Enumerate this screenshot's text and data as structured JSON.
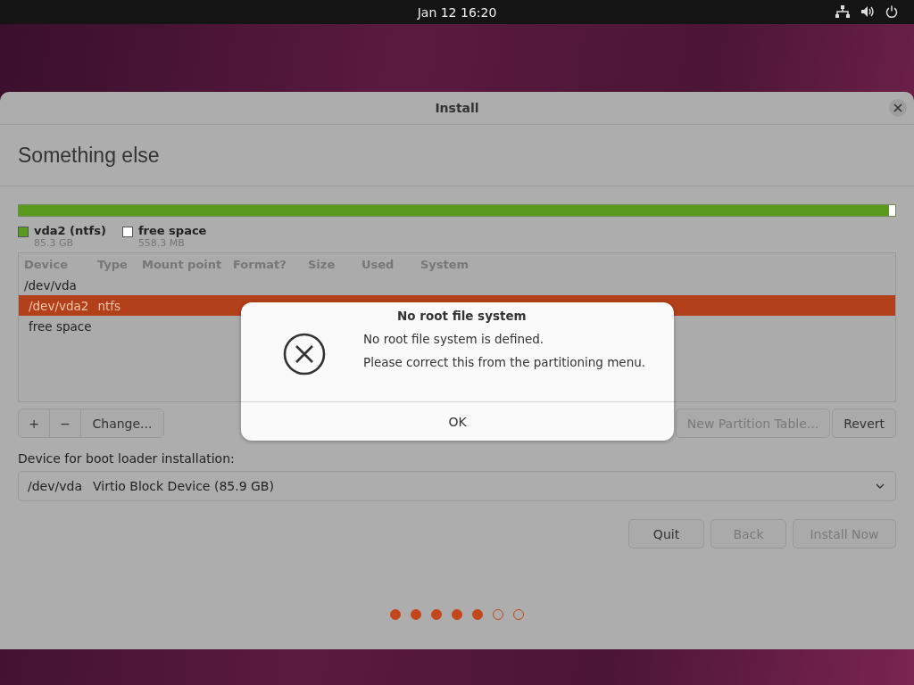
{
  "top_bar": {
    "clock": "Jan 12  16:20"
  },
  "window": {
    "title": "Install"
  },
  "page_title": "Something else",
  "disk_bar": {
    "segments": [
      {
        "label": "vda2 (ntfs)",
        "size": "85.3 GB",
        "color": "#5a9a1e",
        "level": 0.993
      },
      {
        "label": "free space",
        "size": "558.3 MB",
        "color": "#ffffff",
        "level": 0.007
      }
    ]
  },
  "table": {
    "columns": [
      "Device",
      "Type",
      "Mount point",
      "Format?",
      "Size",
      "Used",
      "System"
    ],
    "rows": [
      {
        "device": "/dev/vda",
        "selected": false,
        "children": [
          {
            "device": "/dev/vda2",
            "type": "ntfs",
            "selected": true
          },
          {
            "device": "free space",
            "selected": false
          }
        ]
      }
    ]
  },
  "partition_buttons": [
    {
      "label": "+",
      "disabled": false
    },
    {
      "label": "−",
      "disabled": false
    },
    {
      "label": "Change...",
      "disabled": false
    }
  ],
  "table_buttons": [
    {
      "label": "New Partition Table...",
      "disabled": true
    },
    {
      "label": "Revert",
      "disabled": false
    }
  ],
  "boot_loader": {
    "label": "Device for boot loader installation:",
    "device": "/dev/vda",
    "description": "Virtio Block Device (85.9 GB)"
  },
  "nav_buttons": [
    {
      "label": "Quit",
      "disabled": false
    },
    {
      "label": "Back",
      "disabled": true
    },
    {
      "label": "Install Now",
      "disabled": true
    }
  ],
  "steps": [
    {
      "done": true
    },
    {
      "done": true
    },
    {
      "done": true
    },
    {
      "done": true
    },
    {
      "done": true
    },
    {
      "done": false
    },
    {
      "done": false
    }
  ],
  "dialog": {
    "title": "No root file system",
    "message": "No root file system is defined.",
    "detail": "Please correct this from the partitioning menu.",
    "button": "OK"
  }
}
